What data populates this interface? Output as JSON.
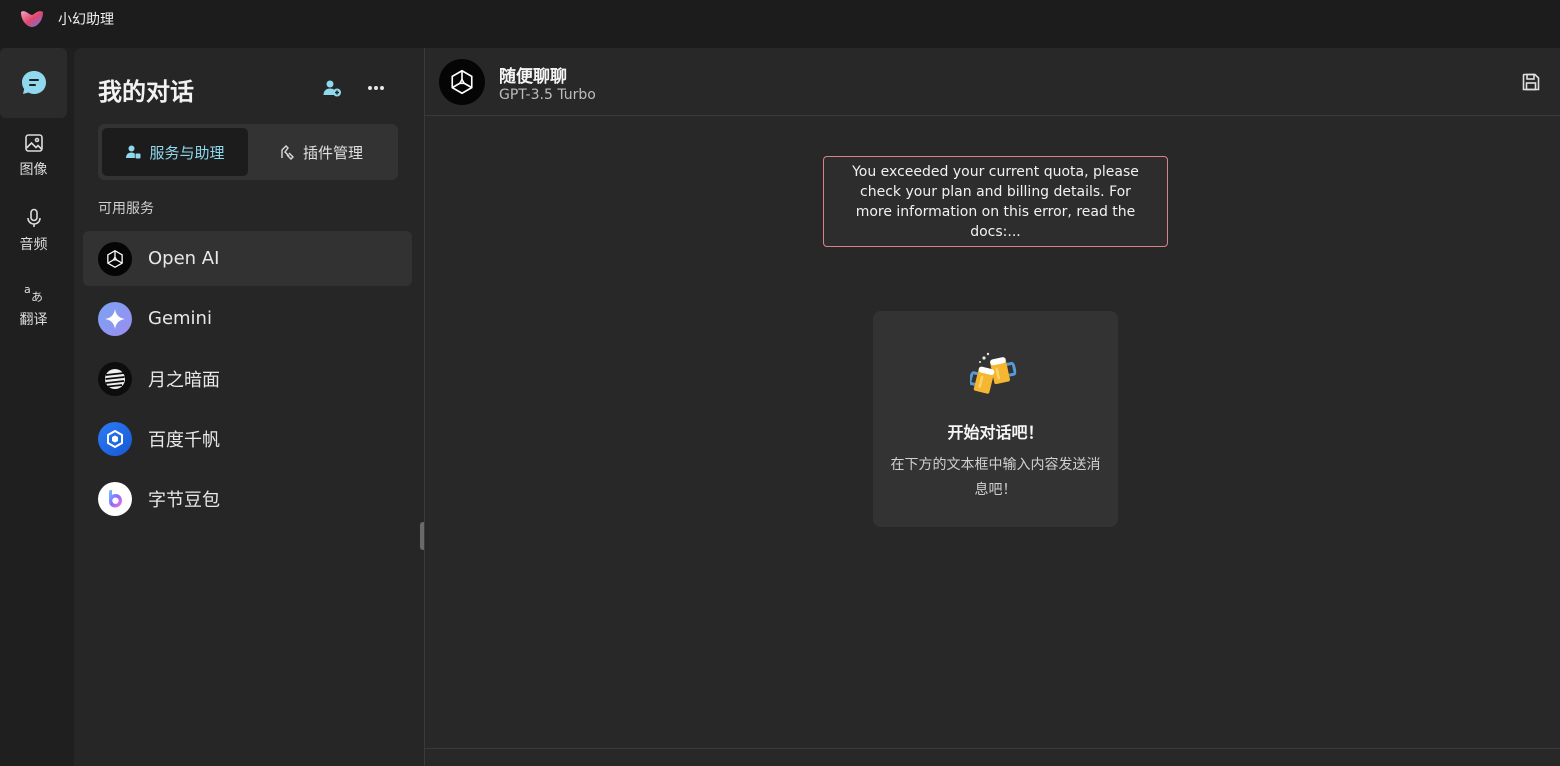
{
  "app": {
    "title": "小幻助理"
  },
  "rail": {
    "items": [
      {
        "label": "",
        "icon": "chat-icon"
      },
      {
        "label": "图像",
        "icon": "image-icon"
      },
      {
        "label": "音频",
        "icon": "mic-icon"
      },
      {
        "label": "翻译",
        "icon": "translate-icon"
      }
    ]
  },
  "sidebar": {
    "title": "我的对话",
    "tabs": [
      {
        "label": "服务与助理",
        "icon": "assistant-icon",
        "active": true
      },
      {
        "label": "插件管理",
        "icon": "plugin-icon",
        "active": false
      }
    ],
    "section_label": "可用服务",
    "services": [
      {
        "name": "Open AI",
        "icon": "openai-logo-icon",
        "active": true
      },
      {
        "name": "Gemini",
        "icon": "gemini-logo-icon",
        "active": false
      },
      {
        "name": "月之暗面",
        "icon": "moonshot-logo-icon",
        "active": false
      },
      {
        "name": "百度千帆",
        "icon": "qianfan-logo-icon",
        "active": false
      },
      {
        "name": "字节豆包",
        "icon": "doubao-logo-icon",
        "active": false
      }
    ]
  },
  "chat": {
    "title": "随便聊聊",
    "model": "GPT-3.5 Turbo",
    "error_message": "You exceeded your current quota, please check your plan and billing details. For more information on this error, read the docs:...",
    "empty_title": "开始对话吧！",
    "empty_subtitle": "在下方的文本框中输入内容发送消息吧！"
  },
  "colors": {
    "accent": "#8fd8ee",
    "error_border": "#d9828c",
    "background": "#282828"
  }
}
